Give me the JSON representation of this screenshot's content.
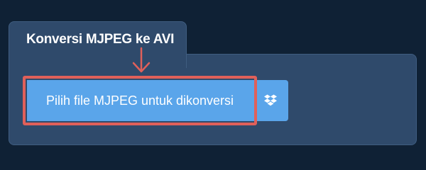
{
  "converter": {
    "title": "Konversi MJPEG ke AVI",
    "choose_file_label": "Pilih file MJPEG untuk dikonversi",
    "dropbox_icon": "dropbox-icon"
  },
  "colors": {
    "background": "#0f2135",
    "panel": "#2f4a6b",
    "button": "#5aa5ea",
    "highlight": "#e0605a"
  }
}
